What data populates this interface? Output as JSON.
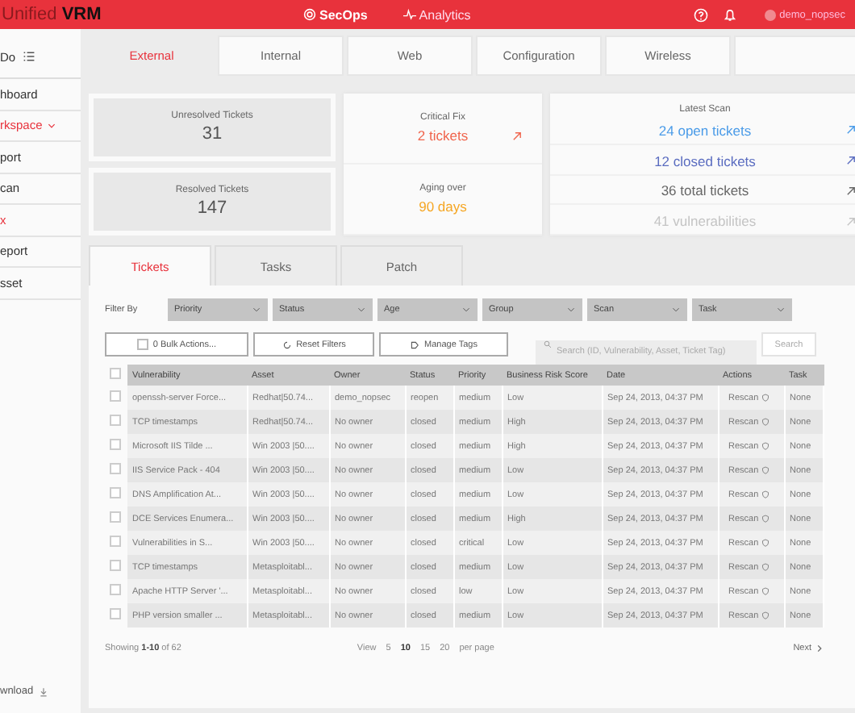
{
  "header": {
    "brand_light": "Unified",
    "brand_bold": "VRM",
    "nav": [
      {
        "label": "SecOps",
        "selected": true
      },
      {
        "label": "Analytics",
        "selected": false
      }
    ],
    "user": "demo_nopsec"
  },
  "sidebar": {
    "title": "Do",
    "items": [
      {
        "label": "hboard",
        "active": false,
        "kind": "link"
      },
      {
        "label": "rkspace",
        "active": true,
        "kind": "group",
        "expanded": true
      },
      {
        "label": "port",
        "active": false,
        "kind": "link"
      },
      {
        "label": "can",
        "active": false,
        "kind": "link"
      },
      {
        "label": "x",
        "active": true,
        "kind": "link"
      },
      {
        "label": "eport",
        "active": false,
        "kind": "link"
      },
      {
        "label": "sset",
        "active": false,
        "kind": "link"
      }
    ],
    "footer": "wnload"
  },
  "tabs": [
    {
      "label": "External",
      "selected": true
    },
    {
      "label": "Internal",
      "selected": false
    },
    {
      "label": "Web",
      "selected": false
    },
    {
      "label": "Configuration",
      "selected": false
    },
    {
      "label": "Wireless",
      "selected": false
    }
  ],
  "stats": [
    {
      "label": "Unresolved Tickets",
      "value": "31"
    },
    {
      "label": "Resolved Tickets",
      "value": "147"
    }
  ],
  "critical": [
    {
      "label": "Critical Fix",
      "value": "2 tickets",
      "color": "#f0644c",
      "arrow": true
    },
    {
      "label": "Aging over",
      "value": "90 days",
      "color": "#f5a623"
    }
  ],
  "latest_scan": {
    "title": "Latest Scan",
    "items": [
      {
        "text": "24 open tickets",
        "color": "#4a9be8"
      },
      {
        "text": "12 closed tickets",
        "color": "#5a6cc0"
      },
      {
        "text": "36 total tickets",
        "color": "#666666"
      },
      {
        "text": "41 vulnerabilities",
        "color": "#c4c4c4"
      }
    ]
  },
  "subtabs": [
    {
      "label": "Tickets",
      "selected": true
    },
    {
      "label": "Tasks",
      "selected": false
    },
    {
      "label": "Patch",
      "selected": false
    }
  ],
  "filter_label": "Filter By",
  "filters": [
    "Priority",
    "Status",
    "Age",
    "Group",
    "Scan",
    "Task"
  ],
  "actions": {
    "bulk": "0 Bulk Actions...",
    "reset": "Reset Filters",
    "tags": "Manage Tags",
    "search_placeholder": "Search (ID, Vulnerability, Asset, Ticket Tag)",
    "search_button": "Search"
  },
  "table": {
    "header_checked": false,
    "columns": [
      "Vulnerability",
      "Asset",
      "Owner",
      "Status",
      "Priority",
      "Business Risk Score",
      "Date",
      "Actions",
      "Task"
    ],
    "rows": [
      {
        "checked": false,
        "cells": [
          "openssh-server Force...",
          "Redhat|50.74...",
          "demo_nopsec",
          "reopen",
          "medium",
          "Low",
          "Sep 24, 2013, 04:37 PM",
          "Rescan",
          "None"
        ]
      },
      {
        "checked": false,
        "cells": [
          "TCP timestamps",
          "Redhat|50.74...",
          "No owner",
          "closed",
          "medium",
          "High",
          "Sep 24, 2013, 04:37 PM",
          "Rescan",
          "None"
        ]
      },
      {
        "checked": false,
        "cells": [
          "Microsoft IIS Tilde ...",
          "Win 2003 |50....",
          "No owner",
          "closed",
          "medium",
          "High",
          "Sep 24, 2013, 04:37 PM",
          "Rescan",
          "None"
        ]
      },
      {
        "checked": false,
        "cells": [
          "IIS Service Pack - 404",
          "Win 2003 |50....",
          "No owner",
          "closed",
          "medium",
          "Low",
          "Sep 24, 2013, 04:37 PM",
          "Rescan",
          "None"
        ]
      },
      {
        "checked": false,
        "cells": [
          "DNS Amplification At...",
          "Win 2003 |50....",
          "No owner",
          "closed",
          "medium",
          "Low",
          "Sep 24, 2013, 04:37 PM",
          "Rescan",
          "None"
        ]
      },
      {
        "checked": false,
        "cells": [
          "DCE Services Enumera...",
          "Win 2003 |50....",
          "No owner",
          "closed",
          "medium",
          "High",
          "Sep 24, 2013, 04:37 PM",
          "Rescan",
          "None"
        ]
      },
      {
        "checked": false,
        "cells": [
          "Vulnerabilities in S...",
          "Win 2003 |50....",
          "No owner",
          "closed",
          "critical",
          "Low",
          "Sep 24, 2013, 04:37 PM",
          "Rescan",
          "None"
        ]
      },
      {
        "checked": false,
        "cells": [
          "TCP timestamps",
          "Metasploitabl...",
          "No owner",
          "closed",
          "medium",
          "Low",
          "Sep 24, 2013, 04:37 PM",
          "Rescan",
          "None"
        ]
      },
      {
        "checked": false,
        "cells": [
          "Apache HTTP Server '...",
          "Metasploitabl...",
          "No owner",
          "closed",
          "low",
          "Low",
          "Sep 24, 2013, 04:37 PM",
          "Rescan",
          "None"
        ]
      },
      {
        "checked": false,
        "cells": [
          "PHP version smaller ...",
          "Metasploitabl...",
          "No owner",
          "closed",
          "medium",
          "Low",
          "Sep 24, 2013, 04:37 PM",
          "Rescan",
          "None"
        ]
      }
    ]
  },
  "pagination": {
    "showing": "Showing **1-10** of 62",
    "view": "View",
    "sizes": [
      {
        "label": "5",
        "selected": false
      },
      {
        "label": "10",
        "selected": true
      },
      {
        "label": "15",
        "selected": false
      },
      {
        "label": "20",
        "selected": false
      }
    ],
    "per_page": "per page",
    "next": "Next"
  }
}
